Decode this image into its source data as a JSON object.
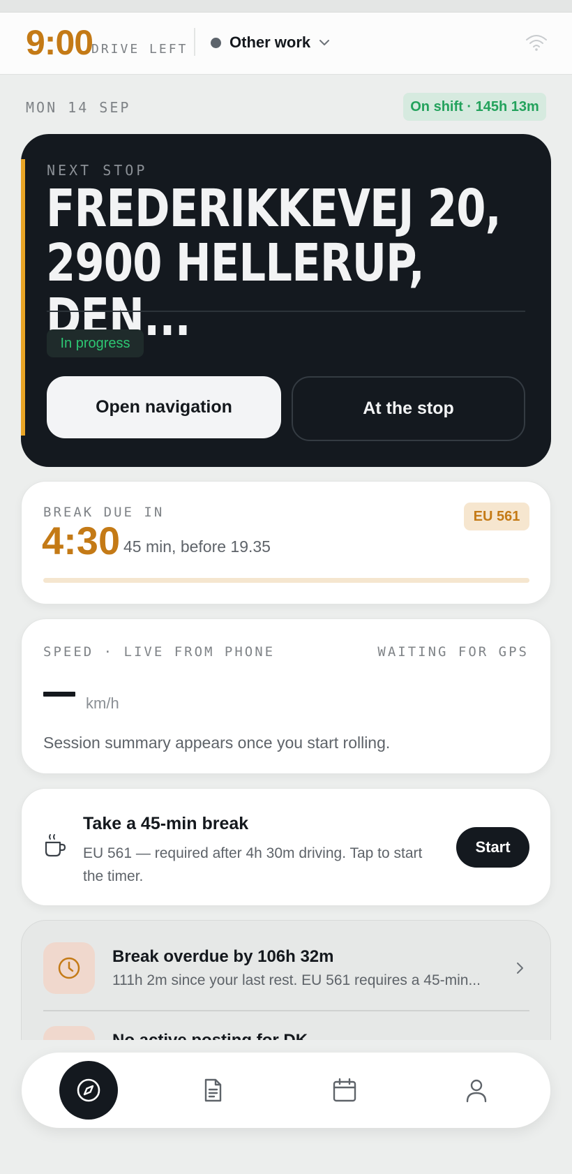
{
  "header": {
    "drive_time": "9:00",
    "drive_label": "DRIVE LEFT",
    "status_label": "Other work"
  },
  "date": "MON 14 SEP",
  "shift_status": "On shift · 145h 13m",
  "next_stop": {
    "label": "NEXT STOP",
    "address_line1": "FREDERIKKEVEJ 20,",
    "address_line2": "2900 HELLERUP, DEN...",
    "status": "In progress",
    "primary_button": "Open navigation",
    "secondary_button": "At the stop"
  },
  "break": {
    "label": "BREAK DUE IN",
    "time": "4:30",
    "note": "45 min, before 19.35",
    "badge": "EU 561",
    "progress": 0
  },
  "speed": {
    "label": "SPEED · LIVE FROM PHONE",
    "gps_status": "WAITING FOR GPS",
    "value": "—",
    "unit": "km/h",
    "note": "Session summary appears once you start rolling."
  },
  "take_break": {
    "title": "Take a 45-min break",
    "description": "EU 561 — required after 4h 30m driving. Tap to start the timer.",
    "button": "Start"
  },
  "alerts": [
    {
      "title": "Break overdue by 106h 32m",
      "description": "111h 2m since your last rest. EU 561 requires a 45-min..."
    },
    {
      "title": "No active posting for DK",
      "description": ""
    }
  ],
  "nav": {
    "items": [
      "compass-icon",
      "document-icon",
      "calendar-icon",
      "person-icon"
    ],
    "active_index": 0
  },
  "colors": {
    "accent_amber": "#c47a16",
    "success_green": "#23a25c",
    "dark": "#14191f"
  }
}
